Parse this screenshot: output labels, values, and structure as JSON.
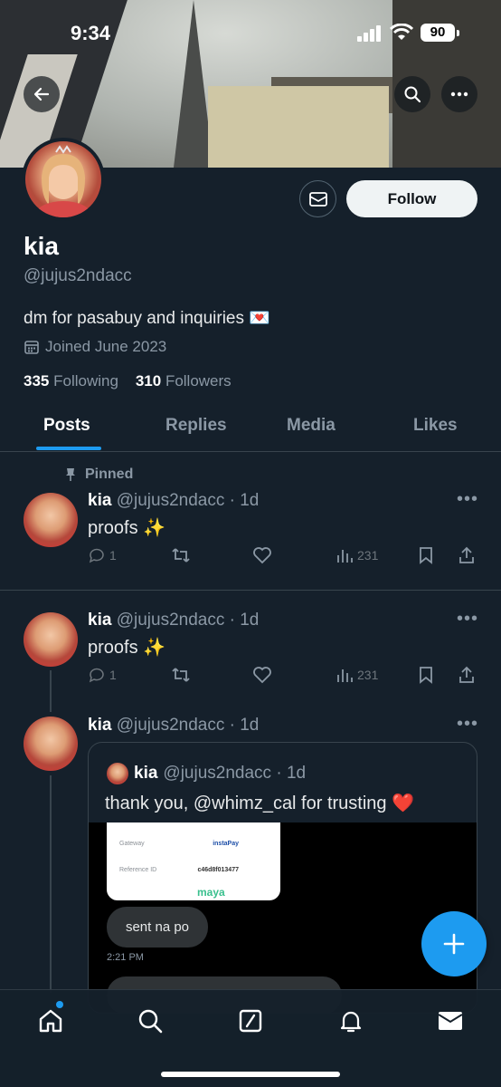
{
  "status_bar": {
    "time": "9:34",
    "battery": "90"
  },
  "profile": {
    "name": "kia",
    "handle": "@jujus2ndacc",
    "bio": "dm for pasabuy and inquiries 💌",
    "joined": "Joined June 2023",
    "following_count": "335",
    "following_label": "Following",
    "followers_count": "310",
    "followers_label": "Followers",
    "follow_button": "Follow"
  },
  "tabs": [
    "Posts",
    "Replies",
    "Media",
    "Likes"
  ],
  "active_tab": "Posts",
  "posts": [
    {
      "pinned_label": "Pinned",
      "name": "kia",
      "meta": "@jujus2ndacc · 1d",
      "text": "proofs ✨",
      "replies": "1",
      "views": "231"
    },
    {
      "name": "kia",
      "meta": "@jujus2ndacc · 1d",
      "text": "proofs ✨",
      "replies": "1",
      "views": "231"
    },
    {
      "name": "kia",
      "meta": "@jujus2ndacc · 1d",
      "quote": {
        "name": "kia",
        "meta": "@jujus2ndacc · 1d",
        "text": "thank you, @whimz_cal for trusting ❤️",
        "receipt": {
          "gateway_label": "Gateway",
          "gateway_value": "instaPay",
          "reference_label": "Reference ID",
          "reference_value": "c46d8f013477",
          "brand": "maya"
        },
        "message": "sent na po",
        "message_time": "2:21 PM"
      }
    }
  ],
  "colors": {
    "background": "#15202b",
    "accent": "#1d9bf0",
    "muted": "#8b98a5"
  }
}
